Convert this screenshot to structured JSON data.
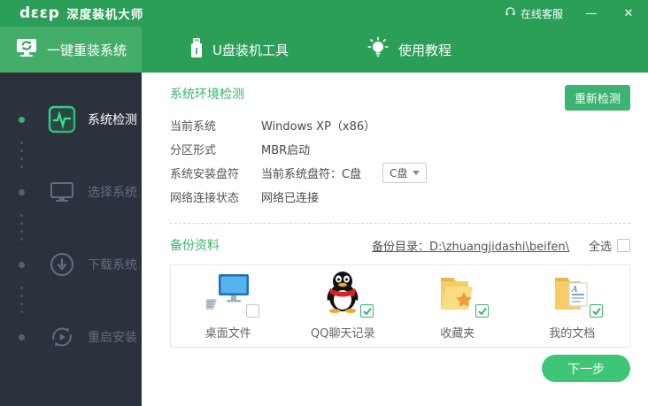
{
  "titlebar": {
    "logo_text": "dεεp",
    "app_name": "深度装机大师",
    "online_service": "在线客服",
    "minimize_label": "—",
    "close_label": "✕"
  },
  "nav": {
    "tabs": [
      {
        "label": "一键重装系统",
        "active": true
      },
      {
        "label": "U盘装机工具",
        "active": false
      },
      {
        "label": "使用教程",
        "active": false
      }
    ]
  },
  "sidebar": {
    "steps": [
      {
        "label": "系统检测",
        "active": true
      },
      {
        "label": "选择系统",
        "active": false
      },
      {
        "label": "下载系统",
        "active": false
      },
      {
        "label": "重启安装",
        "active": false
      }
    ]
  },
  "detection": {
    "title": "系统环境检测",
    "redetect_button": "重新检测",
    "rows": [
      {
        "label": "当前系统",
        "value": "Windows XP（x86）"
      },
      {
        "label": "分区形式",
        "value": "MBR启动"
      },
      {
        "label": "系统安装盘符",
        "value": "当前系统盘符：C盘"
      },
      {
        "label": "网络连接状态",
        "value": "网络已连接"
      }
    ],
    "drive_dropdown_value": "C盘"
  },
  "backup": {
    "title": "备份资料",
    "dir_link": "备份目录：D:\\zhuangjidashi\\beifen\\",
    "select_all_label": "全选",
    "select_all_checked": false,
    "items": [
      {
        "label": "桌面文件",
        "checked": false
      },
      {
        "label": "QQ聊天记录",
        "checked": true
      },
      {
        "label": "收藏夹",
        "checked": true
      },
      {
        "label": "我的文档",
        "checked": true
      }
    ]
  },
  "footer": {
    "next_button": "下一步"
  },
  "colors": {
    "brand_green": "#2b9e58",
    "active_tab_green": "#45ad6a",
    "accent_green": "#3cb371",
    "sidebar_dark": "#2b323d",
    "next_button_green": "#3ec576"
  }
}
